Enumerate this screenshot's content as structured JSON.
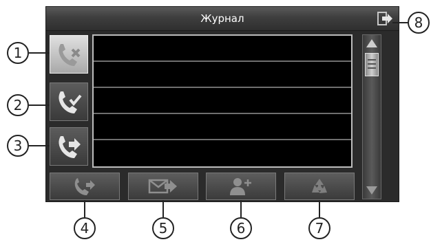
{
  "window": {
    "title": "Журнал"
  },
  "icons": {
    "exit": "exit-icon",
    "missed": "missed-call-icon",
    "received": "received-call-icon",
    "dialed": "dialed-call-icon",
    "call": "call-icon",
    "send": "send-message-icon",
    "add_contact": "add-contact-icon",
    "recycle": "recycle-icon"
  },
  "list": {
    "rows": [
      "",
      "",
      "",
      "",
      ""
    ]
  },
  "callouts": [
    "1",
    "2",
    "3",
    "4",
    "5",
    "6",
    "7",
    "8"
  ],
  "colors": {
    "background": "#2b2b2b",
    "title_text": "#ffffff",
    "list": "#000000"
  }
}
